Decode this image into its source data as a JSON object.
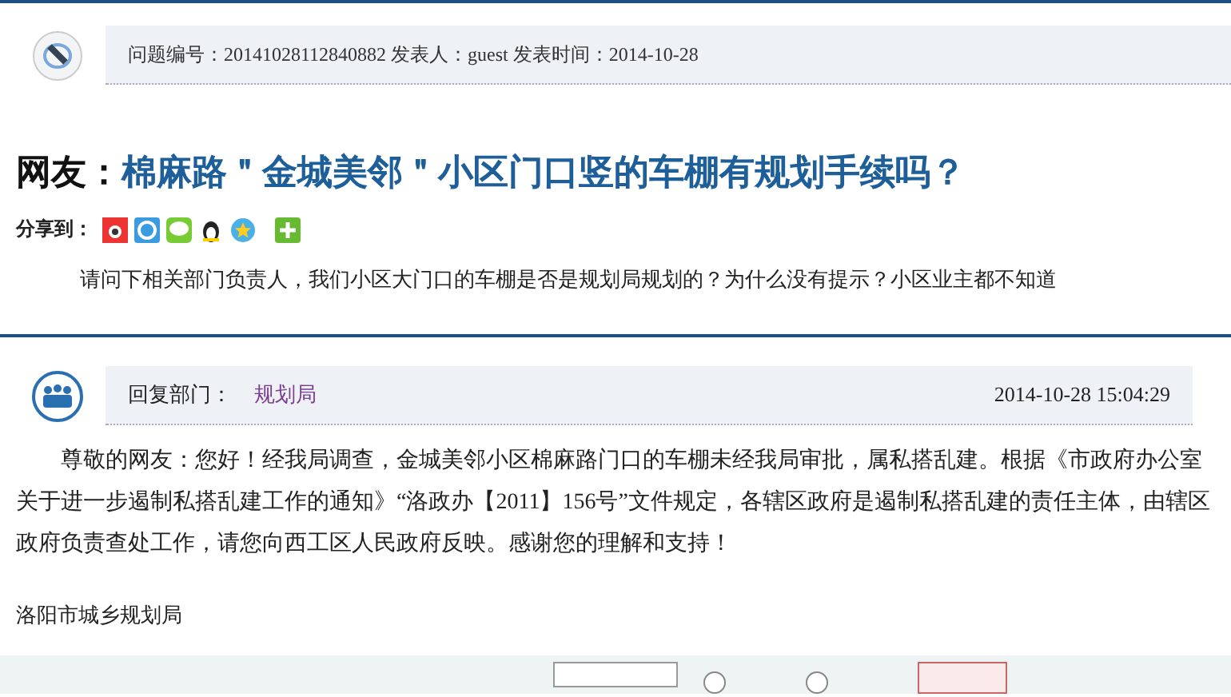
{
  "question": {
    "meta": "问题编号：20141028112840882 发表人：guest 发表时间：2014-10-28",
    "title_prefix": "网友：",
    "title": "棉麻路＂金城美邻＂小区门口竖的车棚有规划手续吗？",
    "share_label": "分享到：",
    "body": "请问下相关部门负责人，我们小区大门口的车棚是否是规划局规划的？为什么没有提示？小区业主都不知道"
  },
  "reply": {
    "dept_label": "回复部门：",
    "dept": "规划局",
    "time": "2014-10-28 15:04:29",
    "body": "尊敬的网友：您好！经我局调查，金城美邻小区棉麻路门口的车棚未经我局审批，属私搭乱建。根据《市政府办公室关于进一步遏制私搭乱建工作的通知》“洛政办【2011】156号”文件规定，各辖区政府是遏制私搭乱建的责任主体，由辖区政府负责查处工作，请您向西工区人民政府反映。感谢您的理解和支持！",
    "signature": "洛阳市城乡规划局"
  },
  "rating_form": {
    "options": [
      {
        "selected": false
      },
      {
        "selected": false
      }
    ]
  }
}
